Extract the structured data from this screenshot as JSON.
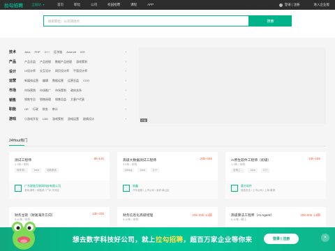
{
  "topnav": {
    "logo": "拉勾招聘",
    "city": "全国站",
    "links": [
      "首页",
      "职位",
      "公司",
      "校园招聘",
      "课程",
      "APP"
    ],
    "login": "登录 | 注册",
    "enterprise": "进入企业版"
  },
  "search": {
    "placeholder": "搜索职位、公司或地点",
    "button": "搜索"
  },
  "categories": [
    {
      "title": "技术",
      "items": [
        "Java",
        "PHP",
        "C++",
        "区块链",
        "Android",
        "iOS"
      ]
    },
    {
      "title": "产品",
      "items": [
        "产品总监",
        "产品经理",
        "数据产品经理",
        "游戏策划"
      ]
    },
    {
      "title": "设计",
      "items": [
        "UI设计师",
        "交互设计",
        "网页设计师",
        "平面设计师"
      ]
    },
    {
      "title": "运营",
      "items": [
        "新媒体运营",
        "编辑",
        "数据运营",
        "运营总监",
        "COO"
      ]
    },
    {
      "title": "市场",
      "items": [
        "市场营销",
        "市场推广",
        "市场策划",
        "政府关系"
      ]
    },
    {
      "title": "销售",
      "items": [
        "销售专员",
        "销售经理",
        "销售总监",
        "大客户代表"
      ]
    },
    {
      "title": "职能",
      "items": [
        "HR",
        "行政",
        "财务",
        "审计"
      ]
    },
    {
      "title": "游戏",
      "items": [
        "小游戏开发",
        "U3D",
        "游戏策划",
        "游戏运营",
        "剧情设计"
      ]
    }
  ],
  "banner": {
    "tag": "广告"
  },
  "section": {
    "title": "24Hour热门"
  },
  "jobs": [
    {
      "title": "测试工程师",
      "salary": "8k-13k",
      "req": "1-3年 / 本科",
      "tags": [
        "软件测...",
        "Java",
        "功能测试"
      ],
      "company": "广东星链互联网科技有限公司",
      "info": "游戏,硬件 / 未融资 / 广州·天河区"
    },
    {
      "title": "高级大数据测试工程师",
      "salary": "20k-35k",
      "req": "3-5年 / 本科",
      "tags": [
        "Debug",
        "Java",
        "C++"
      ],
      "company": "易鑫",
      "info": "汽车金融 / 上市公司 / 深圳·南山区"
    },
    {
      "title": "AI原生软件工程师（初级）",
      "salary": "10k-18k",
      "req": "1-3年 / 本科",
      "tags": [
        "全栈工...",
        "Java",
        "C++"
      ],
      "company": "赛方软件",
      "info": "信息安全 / 上市公司 / 上海·黄浦"
    },
    {
      "title": "财务主管（财富海外方向）",
      "salary": "13k-20k",
      "req": "5-10年 / 本科",
      "tags": [],
      "company": "",
      "info": ""
    },
    {
      "title": "财务信息化高级经理",
      "salary": "20k-25k·14薪",
      "req": "5-10年 / 本科",
      "tags": [],
      "company": "",
      "info": ""
    },
    {
      "title": "高级算法工程师（AI Agent）",
      "salary": "30k-60k·14薪",
      "req": "5-10年 / 硕士",
      "tags": [],
      "company": "",
      "info": ""
    }
  ],
  "promo": {
    "text_prefix": "想去数字科技好公司，就上",
    "text_brand": "拉勾招聘",
    "text_suffix": "，超百万家企业等你来",
    "button": "登录 | 注册",
    "close": "×"
  },
  "colors": {
    "accent": "#00b38a",
    "salary": "#fd5f39",
    "nav_bg": "#2d2d2d"
  }
}
